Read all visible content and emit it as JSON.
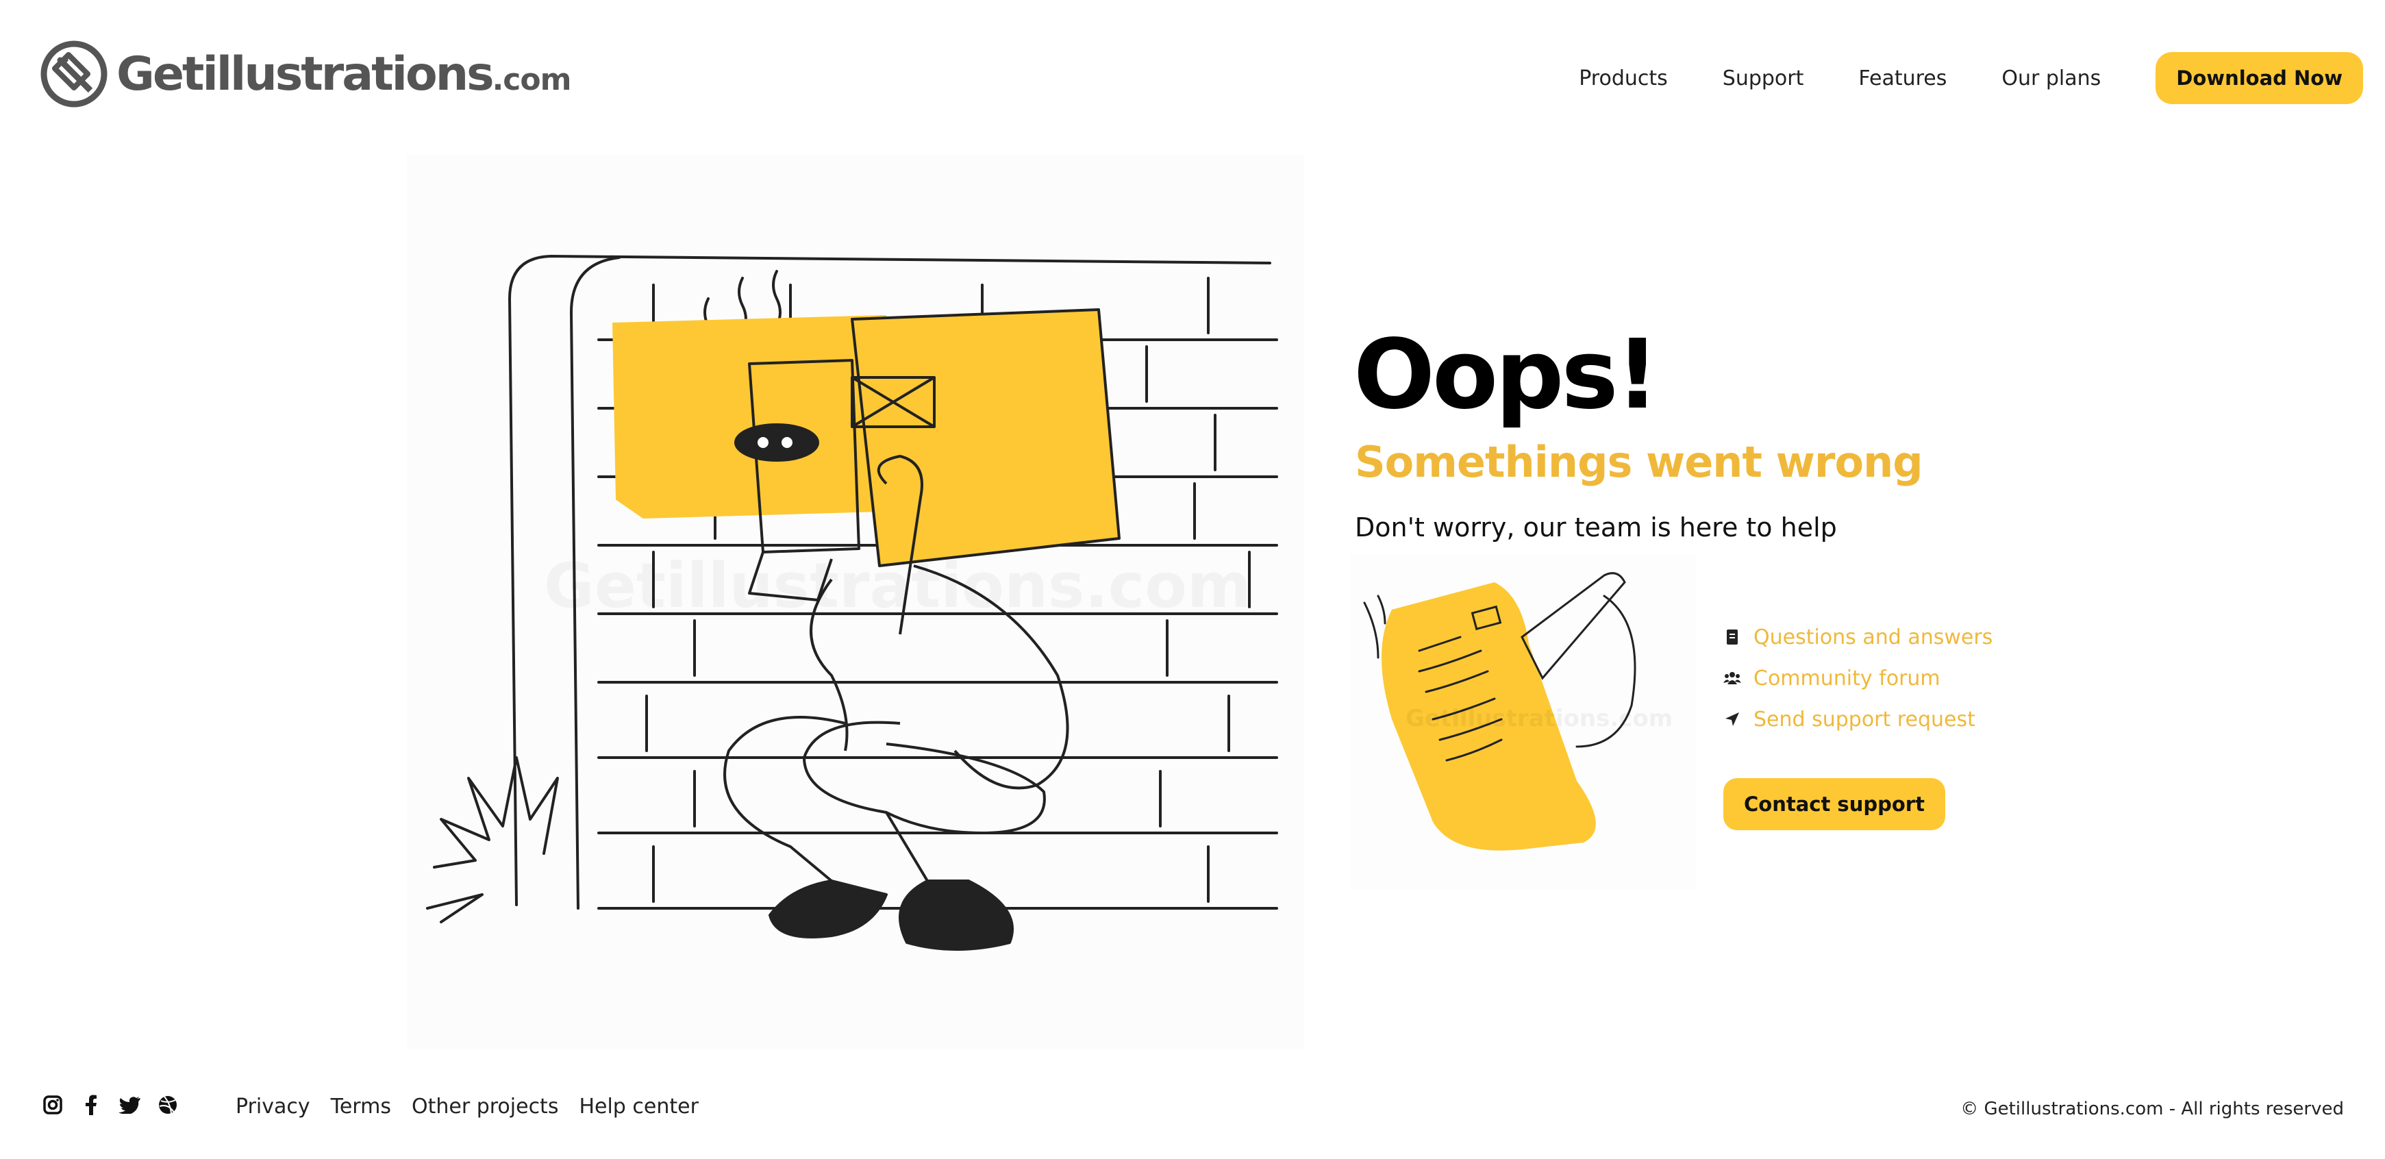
{
  "brand": {
    "name": "Getillustrations",
    "suffix": ".com"
  },
  "nav": {
    "items": [
      "Products",
      "Support",
      "Features",
      "Our plans"
    ],
    "cta_label": "Download Now"
  },
  "hero": {
    "title": "Oops!",
    "subtitle": "Somethings went wrong",
    "tagline": "Don't worry, our team is here to help",
    "illustration_watermark": "Getillustrations.com"
  },
  "support": {
    "links": [
      {
        "label": "Questions and answers",
        "icon": "document-icon"
      },
      {
        "label": "Community forum",
        "icon": "users-icon"
      },
      {
        "label": "Send support request",
        "icon": "send-icon"
      }
    ],
    "contact_label": "Contact support",
    "illustration_watermark": "Getillustrations.com"
  },
  "footer": {
    "social": [
      "instagram-icon",
      "facebook-icon",
      "twitter-icon",
      "dribbble-icon"
    ],
    "links": [
      "Privacy",
      "Terms",
      "Other projects",
      "Help center"
    ],
    "copyright": "© Getillustrations.com - All rights reserved"
  },
  "colors": {
    "accent": "#fdc833",
    "accent_text": "#f0b83a",
    "text": "#111111",
    "logo": "#555555"
  }
}
